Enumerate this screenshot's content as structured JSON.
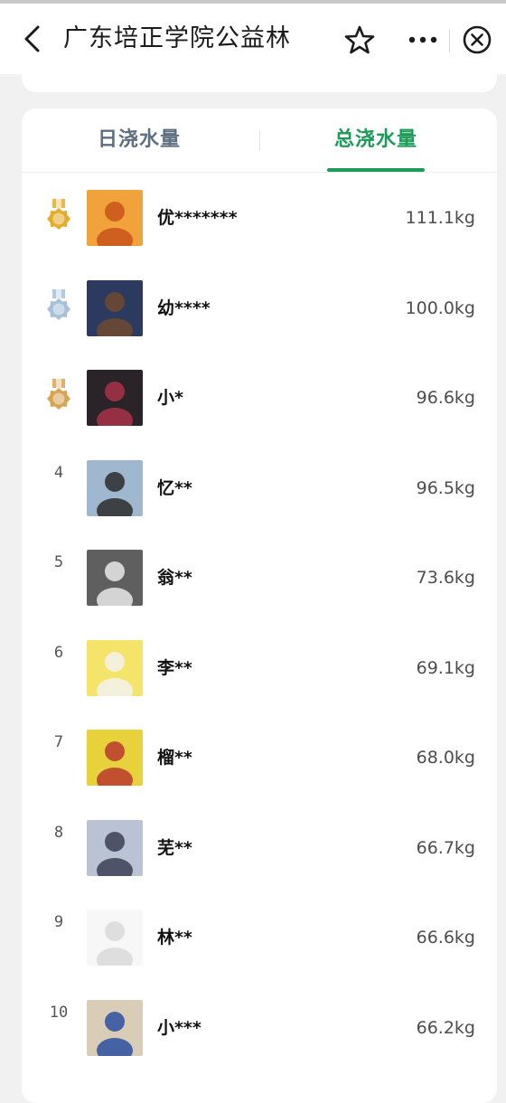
{
  "nav": {
    "title": "广东培正学院公益林",
    "back_icon": "chevron-left-icon",
    "star_icon": "star-icon",
    "more_icon": "more-icon",
    "close_icon": "close-circle-icon"
  },
  "tabs": [
    {
      "label": "日浇水量",
      "selected": false
    },
    {
      "label": "总浇水量",
      "selected": true
    }
  ],
  "colors": {
    "accent": "#1c9a57",
    "tab_inactive": "#5d6f80",
    "gold": "#e5ac2b",
    "silver": "#a6c0d8",
    "bronze": "#d8a453"
  },
  "ranking": [
    {
      "rank": "1",
      "medal": "gold",
      "name": "优*******",
      "amount": "111.1kg"
    },
    {
      "rank": "2",
      "medal": "silver",
      "name": "幼****",
      "amount": "100.0kg"
    },
    {
      "rank": "3",
      "medal": "bronze",
      "name": "小*",
      "amount": "96.6kg"
    },
    {
      "rank": "4",
      "medal": "",
      "name": "忆**",
      "amount": "96.5kg"
    },
    {
      "rank": "5",
      "medal": "",
      "name": "翁**",
      "amount": "73.6kg"
    },
    {
      "rank": "6",
      "medal": "",
      "name": "李**",
      "amount": "69.1kg"
    },
    {
      "rank": "7",
      "medal": "",
      "name": "榴**",
      "amount": "68.0kg"
    },
    {
      "rank": "8",
      "medal": "",
      "name": "芜**",
      "amount": "66.7kg"
    },
    {
      "rank": "9",
      "medal": "",
      "name": "林**",
      "amount": "66.6kg"
    },
    {
      "rank": "10",
      "medal": "",
      "name": "小***",
      "amount": "66.2kg"
    }
  ]
}
